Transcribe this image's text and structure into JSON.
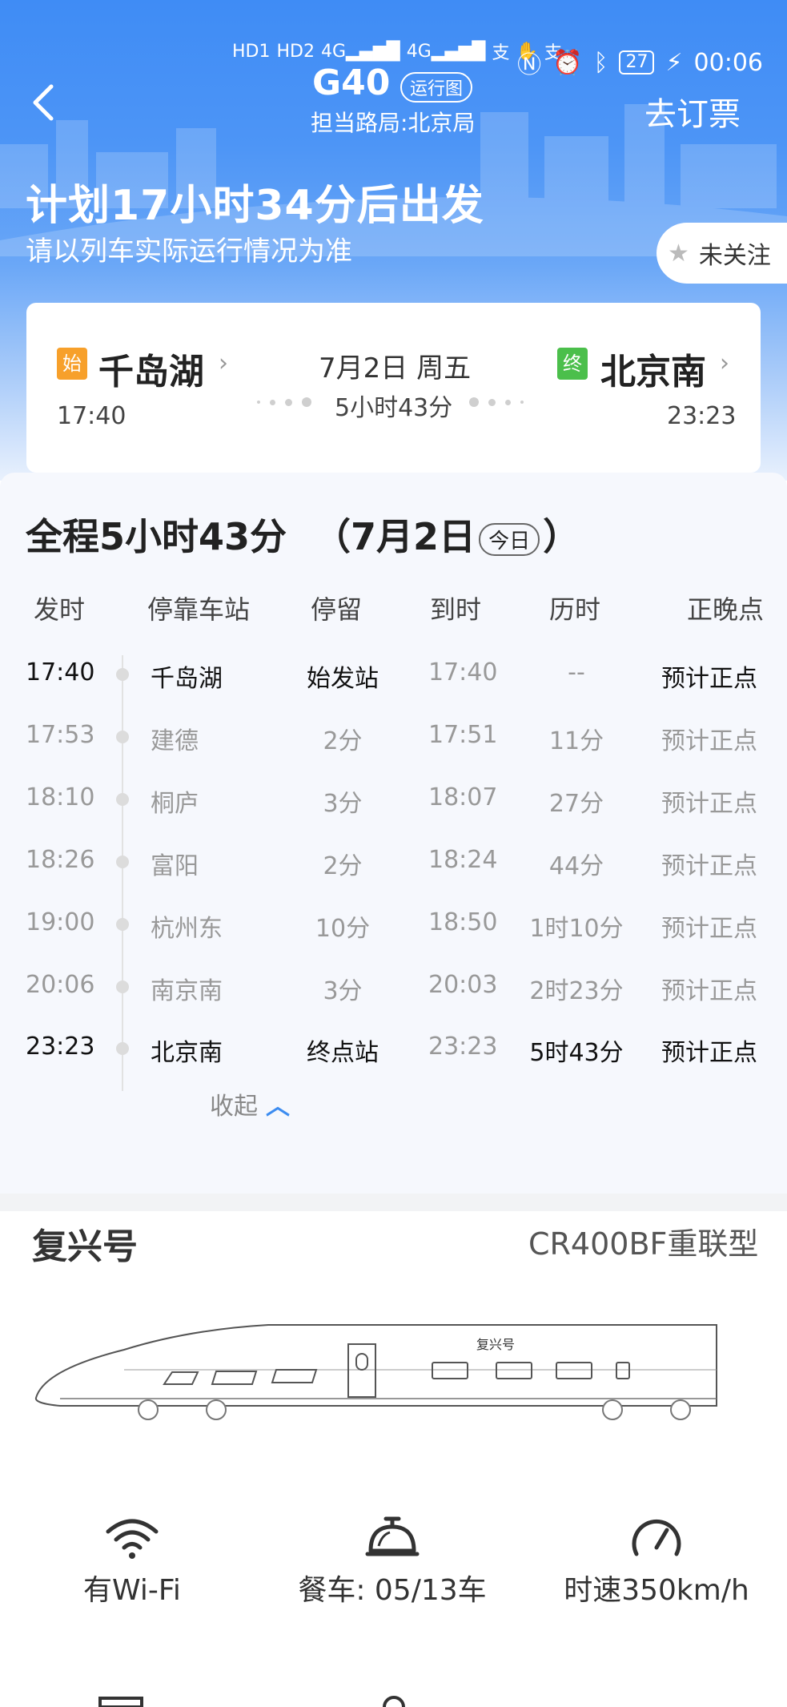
{
  "status_bar": {
    "left_indicators": [
      "HD1",
      "HD2",
      "4G",
      "4G",
      "支",
      "支"
    ],
    "time": "00:06",
    "battery": "27"
  },
  "header": {
    "train_no": "G40",
    "run_map": "运行图",
    "bureau": "担当路局:北京局",
    "book": "去订票"
  },
  "hero": {
    "headline": "计划17小时34分后出发",
    "subline": "请以列车实际运行情况为准",
    "follow": "未关注"
  },
  "route": {
    "origin_badge": "始",
    "origin": "千岛湖",
    "origin_time": "17:40",
    "dest_badge": "终",
    "dest": "北京南",
    "dest_time": "23:23",
    "date": "7月2日 周五",
    "duration": "5小时43分"
  },
  "schedule": {
    "title": "全程5小时43分",
    "date_prefix": "（7月2日",
    "today": "今日",
    "date_suffix": "）",
    "headers": [
      "发时",
      "停靠车站",
      "停留",
      "到时",
      "历时",
      "正晚点"
    ],
    "rows": [
      {
        "dep": "17:40",
        "station": "千岛湖",
        "stay": "始发站",
        "arr": "17:40",
        "dur": "--",
        "status": "预计正点"
      },
      {
        "dep": "17:53",
        "station": "建德",
        "stay": "2分",
        "arr": "17:51",
        "dur": "11分",
        "status": "预计正点"
      },
      {
        "dep": "18:10",
        "station": "桐庐",
        "stay": "3分",
        "arr": "18:07",
        "dur": "27分",
        "status": "预计正点"
      },
      {
        "dep": "18:26",
        "station": "富阳",
        "stay": "2分",
        "arr": "18:24",
        "dur": "44分",
        "status": "预计正点"
      },
      {
        "dep": "19:00",
        "station": "杭州东",
        "stay": "10分",
        "arr": "18:50",
        "dur": "1时10分",
        "status": "预计正点"
      },
      {
        "dep": "20:06",
        "station": "南京南",
        "stay": "3分",
        "arr": "20:03",
        "dur": "2时23分",
        "status": "预计正点"
      },
      {
        "dep": "23:23",
        "station": "北京南",
        "stay": "终点站",
        "arr": "23:23",
        "dur": "5时43分",
        "status": "预计正点"
      }
    ],
    "collapse": "收起"
  },
  "train": {
    "brand": "复兴号",
    "model": "CR400BF重联型",
    "logo_text": "复兴号",
    "features": [
      {
        "icon": "wifi-icon",
        "label": "有Wi-Fi"
      },
      {
        "icon": "dining-bell-icon",
        "label": "餐车: 05/13车"
      },
      {
        "icon": "speedometer-icon",
        "label": "时速350km/h"
      }
    ]
  },
  "colors": {
    "primary_blue": "#3f8cf5",
    "start_badge": "#f7a02b",
    "end_badge": "#4bbf4b",
    "muted_text": "#999999"
  }
}
